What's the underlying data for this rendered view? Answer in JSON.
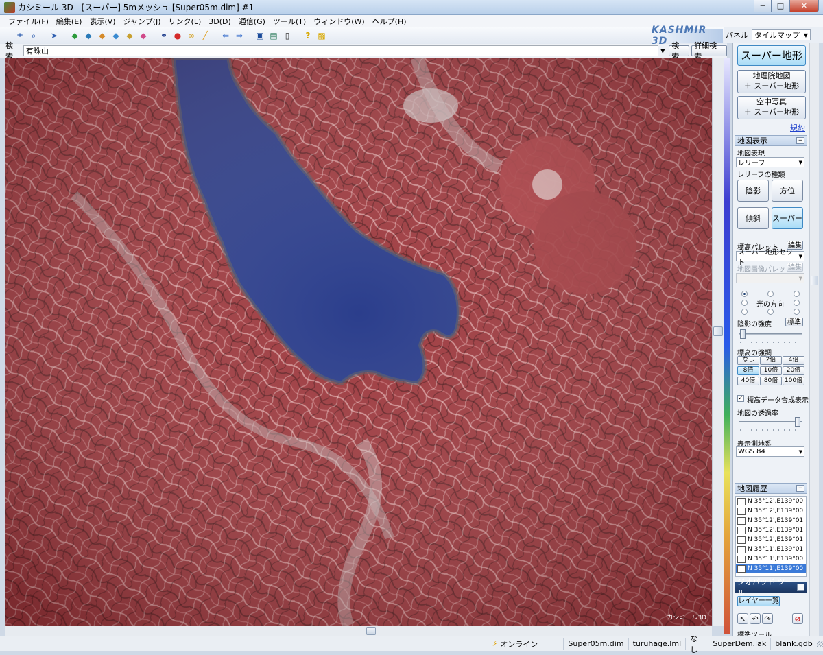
{
  "window": {
    "title": "カシミール 3D - [スーパー]  5mメッシュ [Super05m.dim] #1",
    "minimize": "─",
    "restore": "□",
    "close": "✕"
  },
  "menu": [
    "ファイル(F)",
    "編集(E)",
    "表示(V)",
    "ジャンプ(J)",
    "リンク(L)",
    "3D(D)",
    "通信(G)",
    "ツール(T)",
    "ウィンドウ(W)",
    "ヘルプ(H)"
  ],
  "toolbar": {
    "brand": "KASHMIR 3D"
  },
  "search": {
    "label": "検索",
    "value": "有珠山",
    "search_button": "検索",
    "detail_button": "詳細検索"
  },
  "map": {
    "watermark": "カシミール3D",
    "colors": {
      "terrain": "#9e3a3f",
      "water": "#2b3e8c"
    }
  },
  "panel": {
    "label": "パネル",
    "select": "タイルマップ",
    "super_terrain": "スーパー地形",
    "gsi_map_line1": "地理院地図",
    "gsi_map_line2": "＋ スーパー地形",
    "aerial_line1": "空中写真",
    "aerial_line2": "＋ スーパー地形",
    "terms_link": "規約",
    "map_display": {
      "title": "地図表示",
      "expression_label": "地図表現",
      "expression_value": "レリーフ",
      "relief_type_label": "レリーフの種類",
      "shade": "陰影",
      "direction": "方位",
      "slope": "傾斜",
      "super": "スーパー",
      "palette_label": "標高パレット",
      "edit": "編集",
      "palette_value": "スーパー地形セット",
      "image_palette_label": "地図画像パレット",
      "light_direction": "光の方向",
      "shade_strength": "陰影の強度",
      "standard": "標準",
      "elevation_emphasis": "標高の強調",
      "emphasis_options": [
        "なし",
        "2倍",
        "4倍",
        "8倍",
        "10倍",
        "20倍",
        "40倍",
        "80倍",
        "100倍"
      ],
      "emphasis_selected": "8倍",
      "composite_label": "標高データ合成表示",
      "transparency_label": "地図の透過率",
      "datum_label": "表示測地系",
      "datum_value": "WGS 84"
    },
    "history": {
      "title": "地図履歴",
      "items": [
        "N 35°12',E139°00'",
        "N 35°12',E139°00'",
        "N 35°12',E139°01'",
        "N 35°12',E139°01'",
        "N 35°12',E139°01'",
        "N 35°11',E139°01'",
        "N 35°11',E139°00'",
        "N 35°11',E139°00'"
      ]
    },
    "geopad": {
      "title": "ジオパッド ツール",
      "layer_list": "レイヤー一覧",
      "cutoff": "標準ツール"
    }
  },
  "status": {
    "online": "オンライン",
    "dim": "Super05m.dim",
    "lml": "turuhage.lml",
    "none": "なし",
    "lak": "SuperDem.lak",
    "gdb": "blank.gdb"
  }
}
